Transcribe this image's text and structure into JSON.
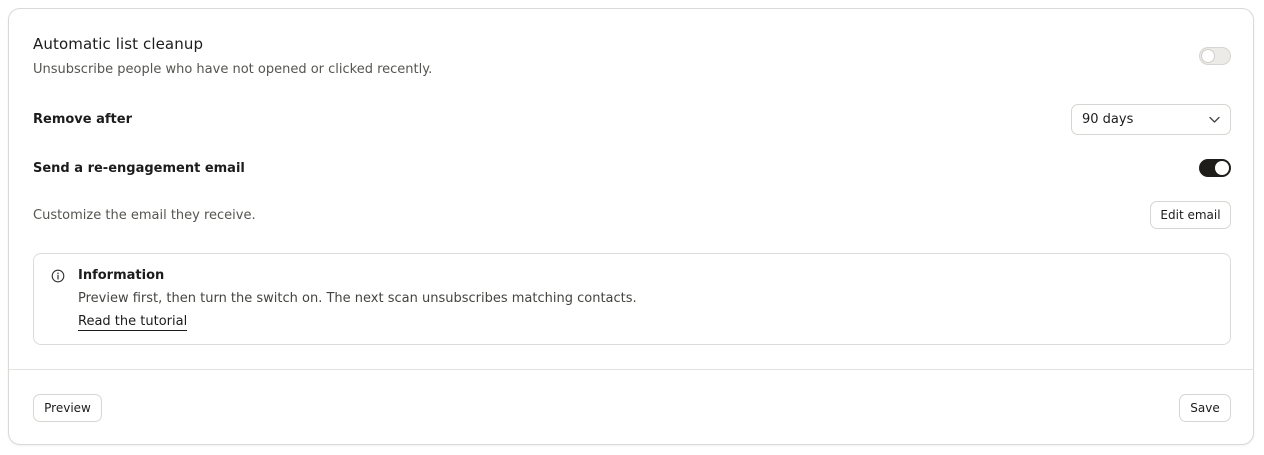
{
  "cleanup": {
    "title": "Automatic list cleanup",
    "subtitle": "Unsubscribe people who have not opened or clicked recently.",
    "enabled": false
  },
  "remove_after": {
    "label": "Remove after",
    "selected": "90 days"
  },
  "reengagement": {
    "label": "Send a re-engagement email",
    "enabled": true,
    "description": "Customize the email they receive.",
    "edit_label": "Edit email"
  },
  "info": {
    "icon": "info-circle-icon",
    "heading": "Information",
    "body": "Preview first, then turn the switch on. The next scan unsubscribes matching contacts.",
    "link": "Read the tutorial"
  },
  "footer": {
    "preview_label": "Preview",
    "save_label": "Save"
  },
  "colors": {
    "toggle_on": "#1f1d1a",
    "toggle_off": "#ecebe8",
    "border": "#d6d5d1"
  }
}
